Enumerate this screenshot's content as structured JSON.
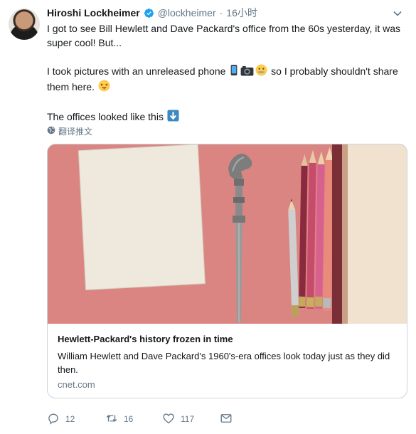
{
  "tweet": {
    "author_name": "Hiroshi Lockheimer",
    "handle": "@lockheimer",
    "separator": "·",
    "time": "16小时",
    "line1": "I got to see Bill Hewlett and Dave Packard's office from the 60s yesterday, it was super cool! But...",
    "line2_prefix": "I took pictures with an unreleased phone",
    "line2_suffix": "so I probably shouldn't share them here.",
    "line3": "The offices looked like this",
    "translate_label": "翻译推文",
    "emojis": [
      "phone-emoji",
      "camera-emoji",
      "zipper-mouth-emoji",
      "tongue-wink-emoji",
      "down-arrow-emoji"
    ]
  },
  "card": {
    "title": "Hewlett-Packard's history frozen in time",
    "description": "William Hewlett and Dave Packard's 1960's-era offices look today just as they did then.",
    "domain": "cnet.com"
  },
  "actions": {
    "reply_count": "12",
    "retweet_count": "16",
    "like_count": "117"
  },
  "colors": {
    "accent": "#1da1f2",
    "muted": "#657786",
    "text": "#14171a",
    "card_bg": "#da7f7e"
  }
}
